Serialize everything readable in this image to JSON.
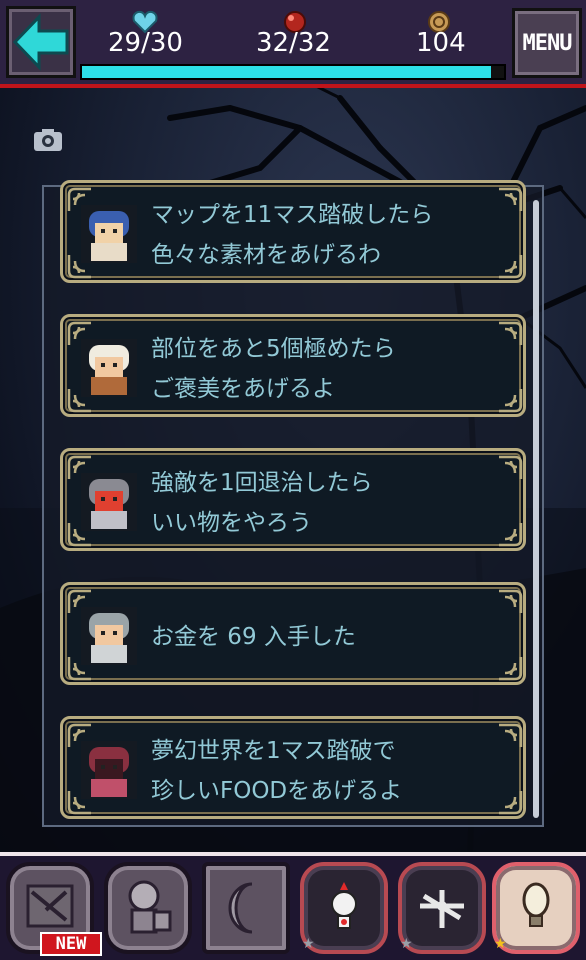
{
  "header": {
    "hp_value": "29/30",
    "hp_fraction": 0.97,
    "orb_value": "32/32",
    "coin_value": "104",
    "menu_label": "MENU",
    "colors": {
      "bar": "#2d2242",
      "hp_fill": "#2de0e8",
      "accent": "#c0141a"
    }
  },
  "quests": [
    {
      "npc": "hooded-girl-portrait",
      "line1": "マップを11マス踏破したら",
      "line2": "色々な素材をあげるわ"
    },
    {
      "npc": "turban-man-portrait",
      "line1": "部位をあと5個極めたら",
      "line2": "ご褒美をあげるよ"
    },
    {
      "npc": "knight-portrait",
      "line1": "強敵を1回退治したら",
      "line2": "いい物をやろう"
    },
    {
      "npc": "soldier-portrait",
      "line1": "お金を 69 入手した",
      "line2": ""
    },
    {
      "npc": "robed-mage-portrait",
      "line1": "夢幻世界を1マス踏破で",
      "line2": "珍しいFOODをあげるよ"
    }
  ],
  "bottom_nav": {
    "new_badge": "NEW",
    "slots": [
      "map-slot",
      "character-slot",
      "moon-slot",
      "chicken-slot",
      "weapon-slot",
      "idea-slot"
    ]
  }
}
